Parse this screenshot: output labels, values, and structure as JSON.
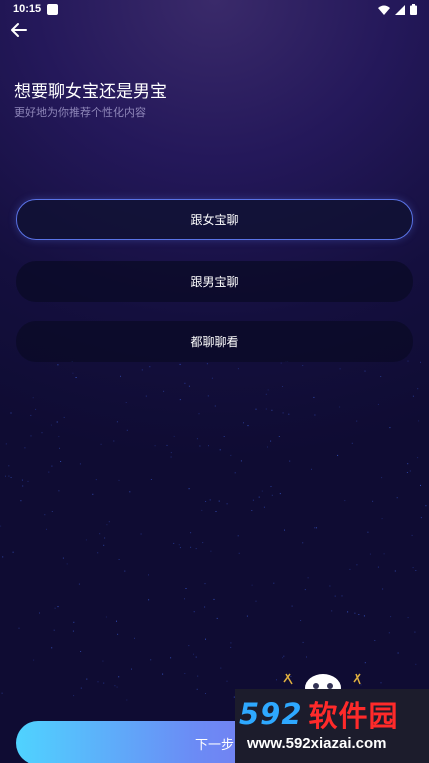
{
  "status_bar": {
    "time": "10:15"
  },
  "header": {
    "back_icon": "arrow-left-icon"
  },
  "main": {
    "title": "想要聊女宝还是男宝",
    "subtitle": "更好地为你推荐个性化内容",
    "options": [
      {
        "label": "跟女宝聊",
        "selected": true
      },
      {
        "label": "跟男宝聊",
        "selected": false
      },
      {
        "label": "都聊聊看",
        "selected": false
      }
    ]
  },
  "footer": {
    "next_label": "下一步"
  },
  "watermark": {
    "digits": "592",
    "chars": "软件园",
    "url": "www.592xiazai.com"
  },
  "colors": {
    "background": "#140f3e",
    "accent_border": "#5a73e6",
    "button_gradient_start": "#4fd3ff",
    "button_gradient_end": "#8a63e8"
  }
}
